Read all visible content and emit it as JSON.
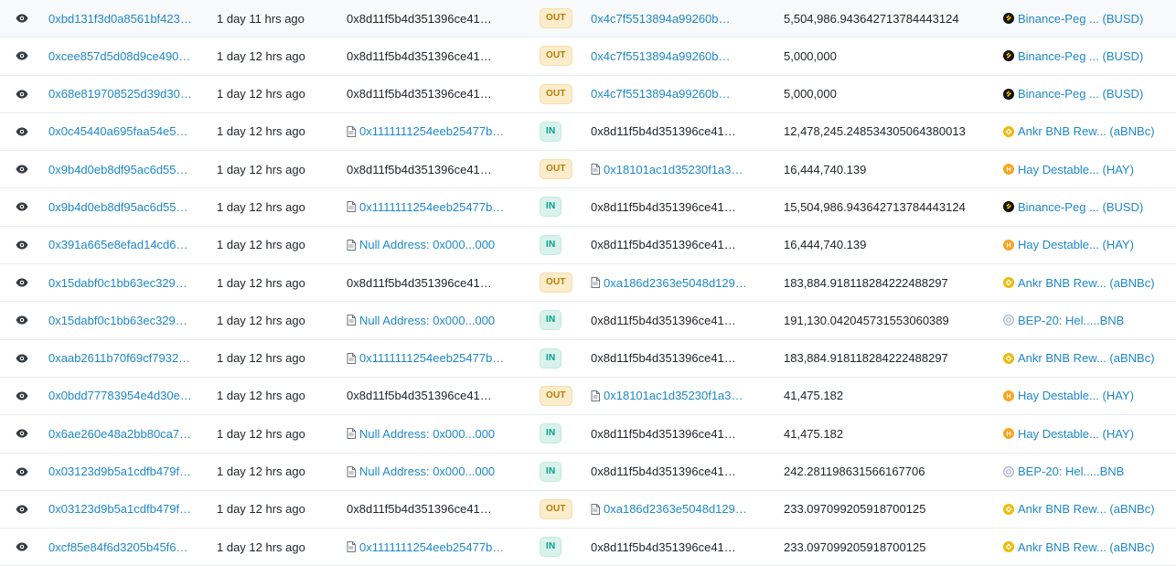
{
  "rows": [
    {
      "hash": "0xbd131f3d0a8561bf423…",
      "age": "1 day 11 hrs ago",
      "from": "0x8d11f5b4d351396ce41…",
      "from_contract": false,
      "from_link": false,
      "dir": "OUT",
      "to": "0x4c7f5513894a99260b…",
      "to_contract": false,
      "to_link": true,
      "qty": "5,504,986.943642713784443124",
      "token": "Binance-Peg ... (BUSD)",
      "token_icon": "busd"
    },
    {
      "hash": "0xcee857d5d08d9ce490…",
      "age": "1 day 12 hrs ago",
      "from": "0x8d11f5b4d351396ce41…",
      "from_contract": false,
      "from_link": false,
      "dir": "OUT",
      "to": "0x4c7f5513894a99260b…",
      "to_contract": false,
      "to_link": true,
      "qty": "5,000,000",
      "token": "Binance-Peg ... (BUSD)",
      "token_icon": "busd"
    },
    {
      "hash": "0x68e819708525d39d30…",
      "age": "1 day 12 hrs ago",
      "from": "0x8d11f5b4d351396ce41…",
      "from_contract": false,
      "from_link": false,
      "dir": "OUT",
      "to": "0x4c7f5513894a99260b…",
      "to_contract": false,
      "to_link": true,
      "qty": "5,000,000",
      "token": "Binance-Peg ... (BUSD)",
      "token_icon": "busd"
    },
    {
      "hash": "0x0c45440a695faa54e5…",
      "age": "1 day 12 hrs ago",
      "from": "0x1111111254eeb25477b…",
      "from_contract": true,
      "from_link": true,
      "dir": "IN",
      "to": "0x8d11f5b4d351396ce41…",
      "to_contract": false,
      "to_link": false,
      "qty": "12,478,245.248534305064380013",
      "token": "Ankr BNB Rew... (aBNBc)",
      "token_icon": "ankr"
    },
    {
      "hash": "0x9b4d0eb8df95ac6d55…",
      "age": "1 day 12 hrs ago",
      "from": "0x8d11f5b4d351396ce41…",
      "from_contract": false,
      "from_link": false,
      "dir": "OUT",
      "to": "0x18101ac1d35230f1a3…",
      "to_contract": true,
      "to_link": true,
      "qty": "16,444,740.139",
      "token": "Hay Destable... (HAY)",
      "token_icon": "hay"
    },
    {
      "hash": "0x9b4d0eb8df95ac6d55…",
      "age": "1 day 12 hrs ago",
      "from": "0x1111111254eeb25477b…",
      "from_contract": true,
      "from_link": true,
      "dir": "IN",
      "to": "0x8d11f5b4d351396ce41…",
      "to_contract": false,
      "to_link": false,
      "qty": "15,504,986.943642713784443124",
      "token": "Binance-Peg ... (BUSD)",
      "token_icon": "busd"
    },
    {
      "hash": "0x391a665e8efad14cd6…",
      "age": "1 day 12 hrs ago",
      "from": "Null Address: 0x000...000",
      "from_contract": true,
      "from_link": true,
      "dir": "IN",
      "to": "0x8d11f5b4d351396ce41…",
      "to_contract": false,
      "to_link": false,
      "qty": "16,444,740.139",
      "token": "Hay Destable... (HAY)",
      "token_icon": "hay"
    },
    {
      "hash": "0x15dabf0c1bb63ec329…",
      "age": "1 day 12 hrs ago",
      "from": "0x8d11f5b4d351396ce41…",
      "from_contract": false,
      "from_link": false,
      "dir": "OUT",
      "to": "0xa186d2363e5048d129…",
      "to_contract": true,
      "to_link": true,
      "qty": "183,884.918118284222488297",
      "token": "Ankr BNB Rew... (aBNBc)",
      "token_icon": "ankr"
    },
    {
      "hash": "0x15dabf0c1bb63ec329…",
      "age": "1 day 12 hrs ago",
      "from": "Null Address: 0x000...000",
      "from_contract": true,
      "from_link": true,
      "dir": "IN",
      "to": "0x8d11f5b4d351396ce41…",
      "to_contract": false,
      "to_link": false,
      "qty": "191,130.042045731553060389",
      "token": "BEP-20: Hel.....BNB",
      "token_icon": "bep"
    },
    {
      "hash": "0xaab2611b70f69cf7932…",
      "age": "1 day 12 hrs ago",
      "from": "0x1111111254eeb25477b…",
      "from_contract": true,
      "from_link": true,
      "dir": "IN",
      "to": "0x8d11f5b4d351396ce41…",
      "to_contract": false,
      "to_link": false,
      "qty": "183,884.918118284222488297",
      "token": "Ankr BNB Rew... (aBNBc)",
      "token_icon": "ankr"
    },
    {
      "hash": "0x0bdd77783954e4d30e…",
      "age": "1 day 12 hrs ago",
      "from": "0x8d11f5b4d351396ce41…",
      "from_contract": false,
      "from_link": false,
      "dir": "OUT",
      "to": "0x18101ac1d35230f1a3…",
      "to_contract": true,
      "to_link": true,
      "qty": "41,475.182",
      "token": "Hay Destable... (HAY)",
      "token_icon": "hay"
    },
    {
      "hash": "0x6ae260e48a2bb80ca7…",
      "age": "1 day 12 hrs ago",
      "from": "Null Address: 0x000...000",
      "from_contract": true,
      "from_link": true,
      "dir": "IN",
      "to": "0x8d11f5b4d351396ce41…",
      "to_contract": false,
      "to_link": false,
      "qty": "41,475.182",
      "token": "Hay Destable... (HAY)",
      "token_icon": "hay"
    },
    {
      "hash": "0x03123d9b5a1cdfb479f…",
      "age": "1 day 12 hrs ago",
      "from": "Null Address: 0x000...000",
      "from_contract": true,
      "from_link": true,
      "dir": "IN",
      "to": "0x8d11f5b4d351396ce41…",
      "to_contract": false,
      "to_link": false,
      "qty": "242.281198631566167706",
      "token": "BEP-20: Hel.....BNB",
      "token_icon": "bep"
    },
    {
      "hash": "0x03123d9b5a1cdfb479f…",
      "age": "1 day 12 hrs ago",
      "from": "0x8d11f5b4d351396ce41…",
      "from_contract": false,
      "from_link": false,
      "dir": "OUT",
      "to": "0xa186d2363e5048d129…",
      "to_contract": true,
      "to_link": true,
      "qty": "233.097099205918700125",
      "token": "Ankr BNB Rew... (aBNBc)",
      "token_icon": "ankr"
    },
    {
      "hash": "0xcf85e84f6d3205b45f6…",
      "age": "1 day 12 hrs ago",
      "from": "0x1111111254eeb25477b…",
      "from_contract": true,
      "from_link": true,
      "dir": "IN",
      "to": "0x8d11f5b4d351396ce41…",
      "to_contract": false,
      "to_link": false,
      "qty": "233.097099205918700125",
      "token": "Ankr BNB Rew... (aBNBc)",
      "token_icon": "ankr"
    }
  ],
  "colors": {
    "link": "#1e88c8",
    "out_bg": "#fbeccb",
    "out_text": "#b47d00",
    "in_bg": "#d9f2ec",
    "in_text": "#00a186",
    "busd": "#111111",
    "ankr": "#f0b90b",
    "hay": "#f5a623",
    "bep": "#a9b4c2"
  }
}
